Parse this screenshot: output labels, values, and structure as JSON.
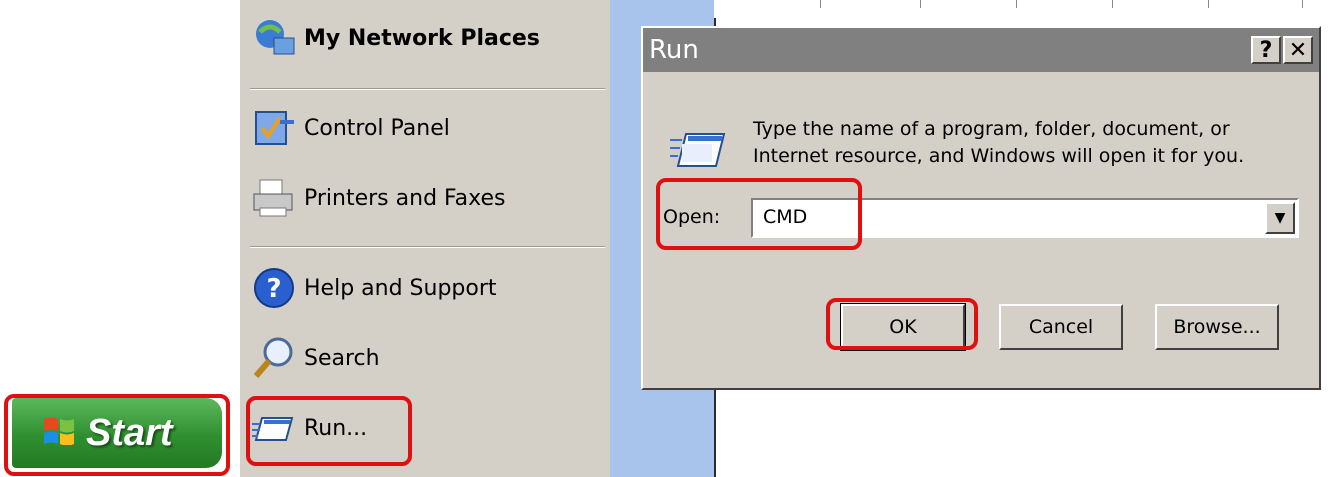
{
  "start_button": {
    "label": "Start"
  },
  "start_menu": {
    "items": [
      {
        "label": "My Network Places",
        "icon": "network-places-icon"
      },
      {
        "label": "Control Panel",
        "icon": "control-panel-icon"
      },
      {
        "label": "Printers and Faxes",
        "icon": "printer-icon"
      },
      {
        "label": "Help and Support",
        "icon": "help-icon"
      },
      {
        "label": "Search",
        "icon": "search-icon"
      },
      {
        "label": "Run...",
        "icon": "run-icon"
      }
    ]
  },
  "run_dialog": {
    "title": "Run",
    "help_label": "?",
    "close_label": "✕",
    "description_line1": "Type the name of a program, folder, document, or",
    "description_line2": "Internet resource, and Windows will open it for you.",
    "open_label": "Open:",
    "open_value": "CMD",
    "ok_label": "OK",
    "cancel_label": "Cancel",
    "browse_label": "Browse..."
  },
  "colors": {
    "highlight": "#e01010",
    "start_green": "#2f8f2f",
    "dialog_gray": "#d4d0c8"
  }
}
